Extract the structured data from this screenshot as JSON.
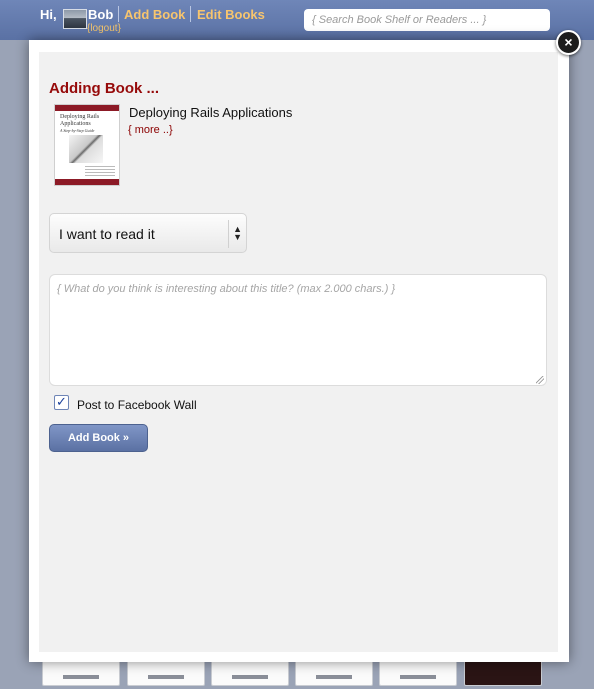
{
  "header": {
    "greeting": "Hi,",
    "user_name": "Bob",
    "logout_label": "{logout}",
    "add_book_label": "Add Book",
    "edit_books_label": "Edit Books",
    "search_placeholder": "{ Search Book Shelf or Readers ... }"
  },
  "modal": {
    "close_label": "×",
    "heading": "Adding Book ...",
    "book": {
      "title": "Deploying Rails Applications",
      "more_label": "{ more ..}",
      "cover_title": "Deploying Rails Applications",
      "cover_subtitle": "A Step-by-Step Guide"
    },
    "status_select": {
      "selected": "I want to read it"
    },
    "comment": {
      "placeholder": "{ What do you think is interesting about this title? (max 2.000 chars.) }",
      "value": ""
    },
    "facebook": {
      "checked": true,
      "label": "Post to Facebook Wall"
    },
    "submit_label": "Add Book »"
  },
  "icons": {
    "close": "close-icon",
    "select_arrows": "chevron-updown-icon",
    "check": "checkmark-icon"
  },
  "colors": {
    "header_bg": "#6f86b8",
    "link": "#f7c56e",
    "heading": "#960a0a",
    "button_bg": "#6a80b3"
  }
}
